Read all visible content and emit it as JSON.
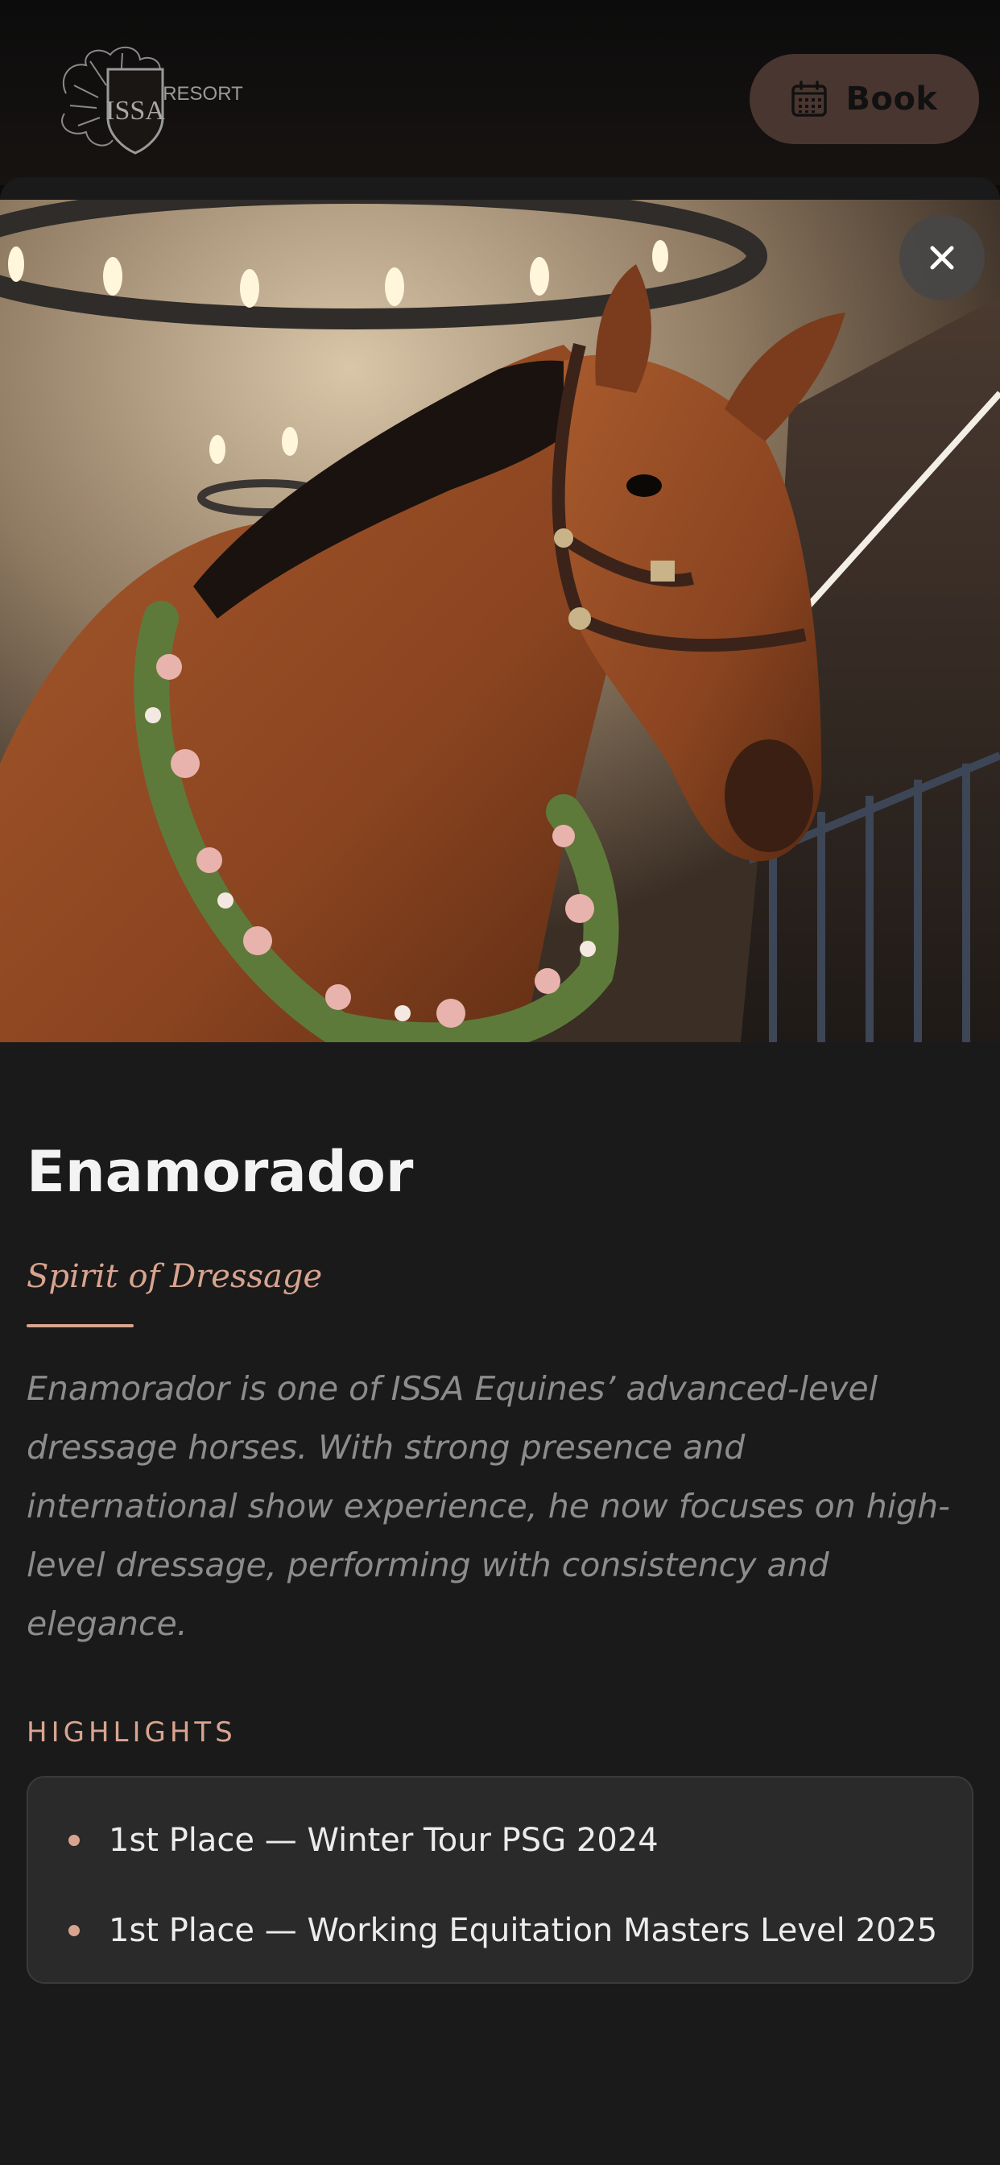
{
  "header": {
    "logo_text": "ISSA RESORT",
    "book_label": "Book",
    "book_icon": "calendar-icon"
  },
  "modal": {
    "close_icon": "close-icon",
    "photo": "horse-portrait-photo"
  },
  "horse": {
    "name": "Enamorador",
    "subtitle": "Spirit of Dressage",
    "description": "Enamorador is one of ISSA Equines’ advanced-level dressage horses. With strong presence and international show experience, he now focuses on high-level dressage, performing with consistency and elegance."
  },
  "highlights": {
    "title": "HIGHLIGHTS",
    "items": [
      "1st Place — Winter Tour PSG 2024",
      "1st Place — Working Equitation Masters Level 2025"
    ]
  },
  "colors": {
    "accent": "#d9a48f",
    "background": "#1a1a1a",
    "book_button": "#4a3630"
  }
}
